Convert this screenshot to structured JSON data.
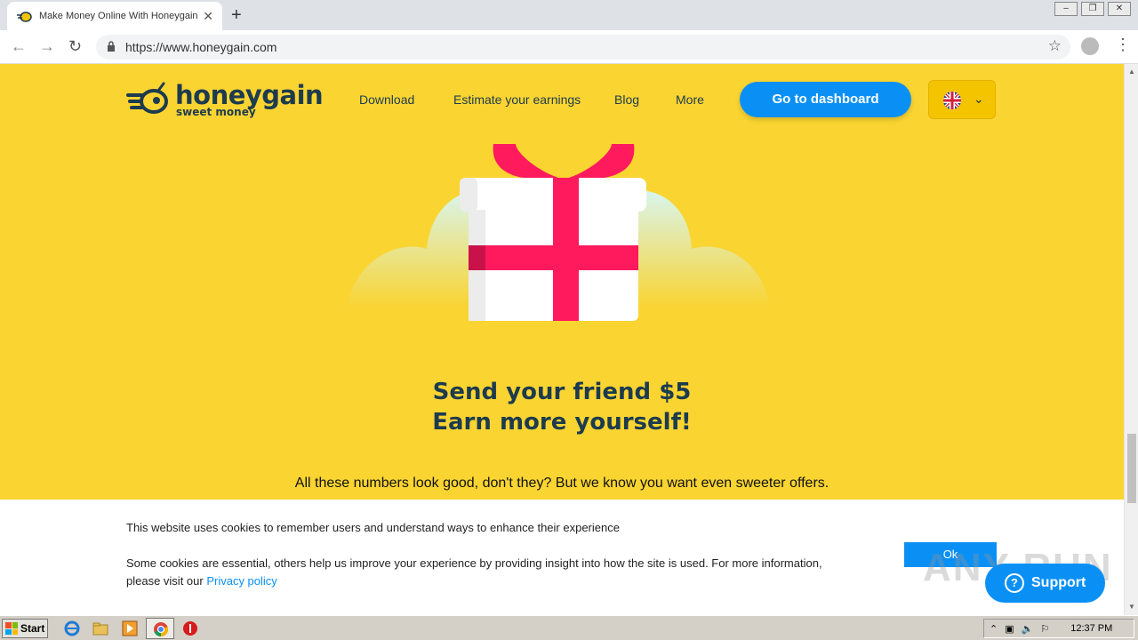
{
  "browser": {
    "tab_title": "Make Money Online With Honeygain",
    "tab_close": "✕",
    "new_tab": "+",
    "url": "https://www.honeygain.com",
    "window_controls": [
      "‒",
      "❐",
      "✕"
    ]
  },
  "header": {
    "logo_word": "honeygain",
    "logo_tagline": "sweet money",
    "nav": [
      "Download",
      "Estimate your earnings",
      "Blog",
      "More"
    ],
    "cta": "Go to dashboard",
    "language_icon": "uk-flag-icon"
  },
  "hero": {
    "headline_line1": "Send your friend $5",
    "headline_line2": "Earn more yourself!",
    "subtext": "All these numbers look good, don't they? But we know you want even sweeter offers."
  },
  "cookie_bar": {
    "line1": "This website uses cookies to remember users and understand ways to enhance their experience",
    "line2": "Some cookies are essential, others help us improve your experience by providing insight into how the site is used. For more information,",
    "line3_prefix": "please visit our ",
    "privacy_link": "Privacy policy",
    "ok_button": "Ok",
    "support_button": "Support"
  },
  "watermark": "ANY RUN",
  "taskbar": {
    "start": "Start",
    "clock": "12:37 PM"
  },
  "colors": {
    "page_background": "#fad431",
    "brand_blue": "#0a90f5",
    "brand_dark": "#1d3b4e",
    "gift_ribbon": "#ff1a5e"
  }
}
